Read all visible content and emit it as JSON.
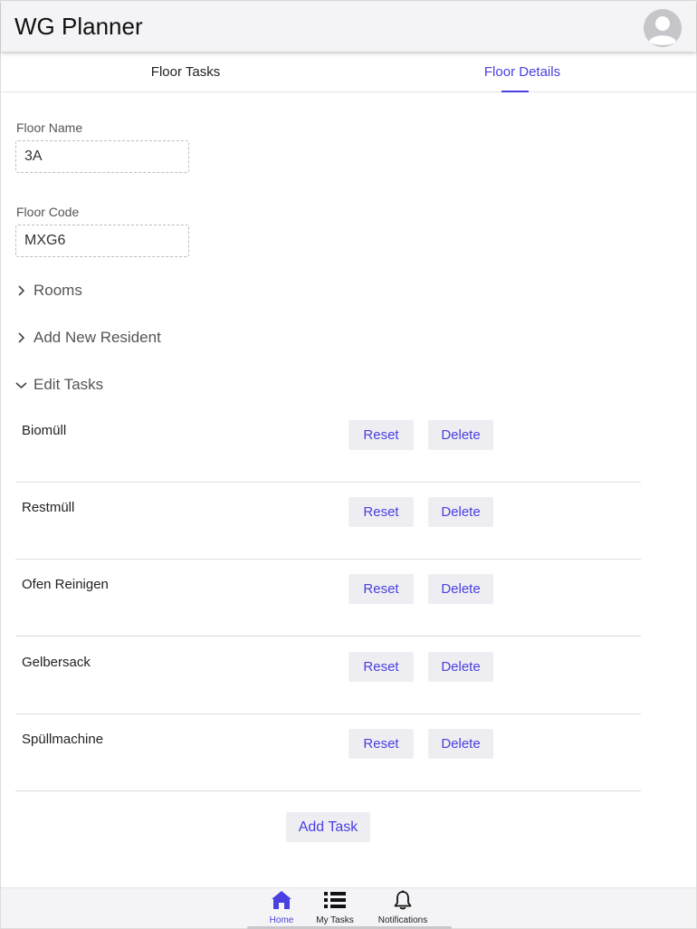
{
  "header": {
    "title": "WG Planner",
    "avatar_icon": "user-avatar-icon"
  },
  "tabs": [
    {
      "label": "Floor Tasks",
      "active": false
    },
    {
      "label": "Floor Details",
      "active": true
    }
  ],
  "fields": {
    "floor_name": {
      "label": "Floor Name",
      "value": "3A"
    },
    "floor_code": {
      "label": "Floor Code",
      "value": "MXG6"
    }
  },
  "sections": {
    "rooms": {
      "label": "Rooms",
      "expanded": false
    },
    "add_resident": {
      "label": "Add New Resident",
      "expanded": false
    },
    "edit_tasks": {
      "label": "Edit Tasks",
      "expanded": true
    }
  },
  "task_buttons": {
    "reset_label": "Reset",
    "delete_label": "Delete"
  },
  "tasks": [
    {
      "name": "Biomüll"
    },
    {
      "name": "Restmüll"
    },
    {
      "name": "Ofen Reinigen"
    },
    {
      "name": "Gelbersack"
    },
    {
      "name": "Spüllmachine"
    }
  ],
  "add_task_label": "Add Task",
  "bottom_nav": [
    {
      "label": "Home",
      "icon": "home-icon",
      "active": true
    },
    {
      "label": "My Tasks",
      "icon": "list-icon",
      "active": false
    },
    {
      "label": "Notifications",
      "icon": "bell-icon",
      "active": false
    }
  ],
  "colors": {
    "accent": "#4a3fe0",
    "button_bg": "#eeeef2",
    "header_bg": "#f4f4f6"
  }
}
